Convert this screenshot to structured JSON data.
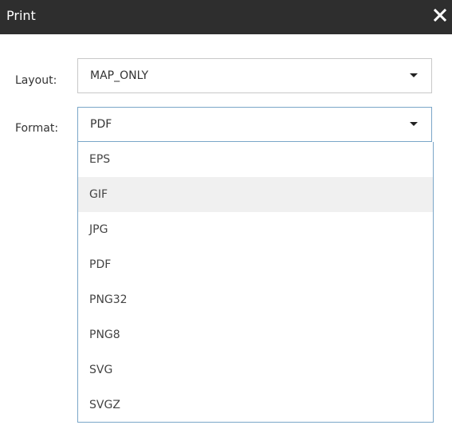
{
  "dialog": {
    "title": "Print",
    "close_icon": "close-icon"
  },
  "layout": {
    "label": "Layout:",
    "value": "MAP_ONLY"
  },
  "format": {
    "label": "Format:",
    "value": "PDF",
    "options": [
      "EPS",
      "GIF",
      "JPG",
      "PDF",
      "PNG32",
      "PNG8",
      "SVG",
      "SVGZ"
    ],
    "highlighted_option": "GIF"
  },
  "colors": {
    "title_bar": "#2e2e2e",
    "focus_border": "#7aa6c8",
    "highlight": "#f0f0f0"
  }
}
